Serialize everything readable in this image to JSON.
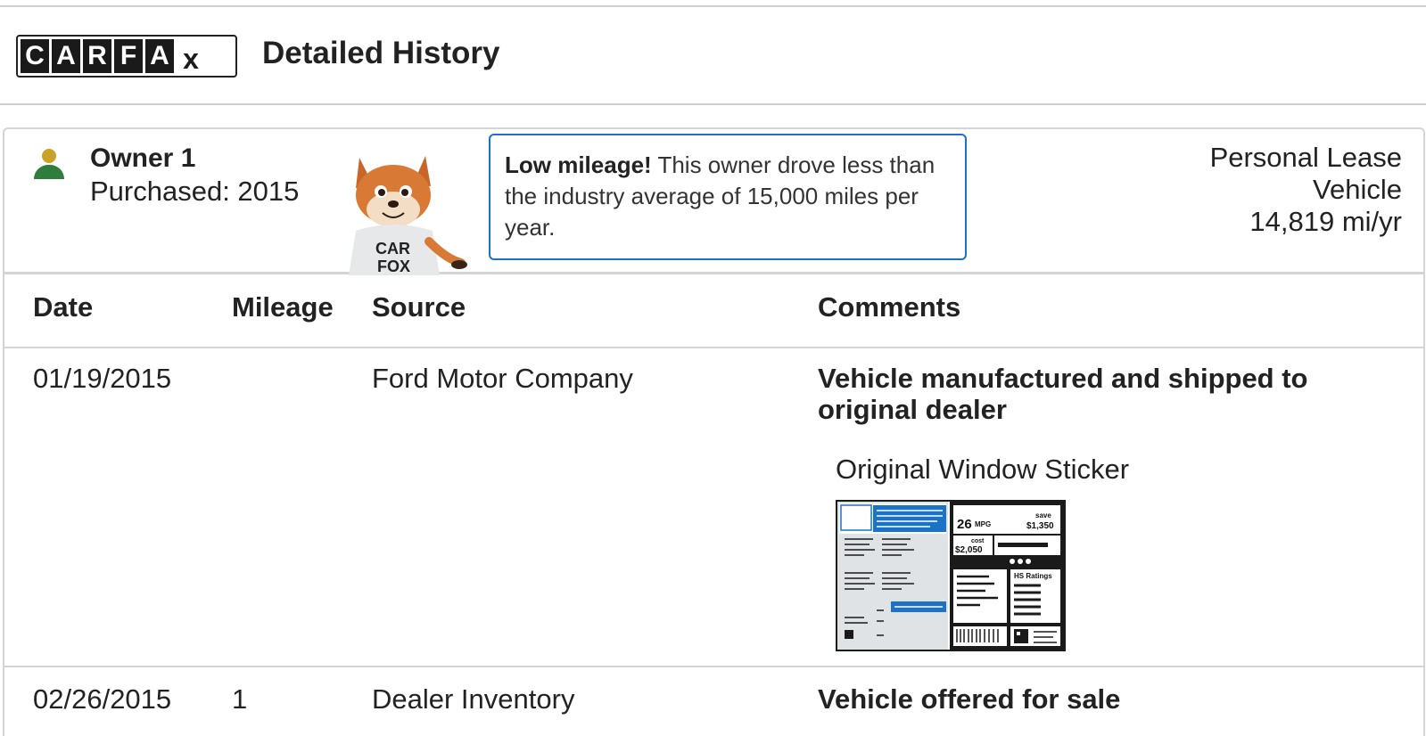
{
  "header": {
    "logo_letters": [
      "C",
      "A",
      "R",
      "F",
      "A"
    ],
    "logo_suffix": "x",
    "title": "Detailed History"
  },
  "owner": {
    "name": "Owner 1",
    "purchased": "Purchased: 2015",
    "tip_bold": "Low mileage!",
    "tip_text": " This owner drove less than the industry average of 15,000 miles per year.",
    "type_line1": "Personal Lease",
    "type_line2": "Vehicle",
    "mileage_rate": "14,819 mi/yr",
    "icon_colors": {
      "head": "#c9a227",
      "body": "#2f7d3a"
    }
  },
  "table": {
    "headers": [
      "Date",
      "Mileage",
      "Source",
      "Comments"
    ],
    "rows": [
      {
        "date": "01/19/2015",
        "mileage": "",
        "source": "Ford Motor Company",
        "comment": "Vehicle manufactured and shipped to original dealer",
        "extra": "Original Window Sticker"
      },
      {
        "date": "02/26/2015",
        "mileage": "1",
        "source": "Dealer Inventory",
        "comment": "Vehicle offered for sale"
      }
    ]
  },
  "sticker": {
    "mpg": "26",
    "mpg_unit": "MPG",
    "save_label": "save",
    "save_amount": "$1,350",
    "cost_label": "cost",
    "cost_amount": "$2,050",
    "ratings_label": "HS Ratings"
  },
  "colors": {
    "accent": "#1a73c8",
    "border": "#d4d4d4"
  }
}
